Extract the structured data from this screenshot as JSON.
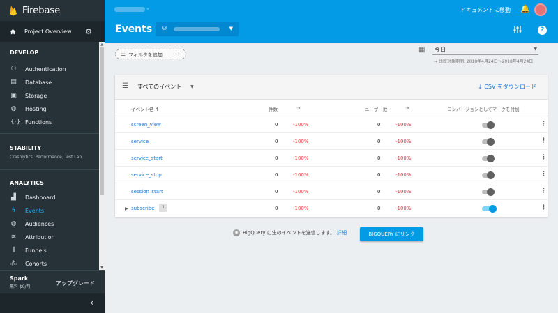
{
  "app": {
    "name": "Firebase"
  },
  "sidebar": {
    "overview_label": "Project Overview",
    "sections": {
      "develop": "DEVELOP",
      "stability": "STABILITY",
      "stability_sub": "Crashlytics, Performance, Test Lab",
      "analytics": "ANALYTICS"
    },
    "develop_items": [
      "Authentication",
      "Database",
      "Storage",
      "Hosting",
      "Functions"
    ],
    "analytics_items": [
      "Dashboard",
      "Events",
      "Audiences",
      "Attribution",
      "Funnels",
      "Cohorts"
    ],
    "active_item": "Events",
    "plan": {
      "name": "Spark",
      "price": "無料 $0/月",
      "upgrade": "アップグレード"
    }
  },
  "header": {
    "docs_link": "ドキュメントに移動",
    "title": "Events"
  },
  "filters": {
    "add_filter": "フィルタを追加",
    "date_range": "今日",
    "compare": "比較対象期間: 2018年4月24日〜2018年4月24日"
  },
  "card": {
    "event_selector": "すべてのイベント",
    "download": "CSV をダウンロード",
    "columns": {
      "name": "イベント名 ↑",
      "count": "件数",
      "users": "ユーザー数",
      "conversion": "コンバージョンとしてマークを付加"
    },
    "rows": [
      {
        "name": "screen_view",
        "count": "0",
        "count_change": "-100%",
        "users": "0",
        "users_change": "-100%",
        "conversion": false
      },
      {
        "name": "service",
        "count": "0",
        "count_change": "-100%",
        "users": "0",
        "users_change": "-100%",
        "conversion": false
      },
      {
        "name": "service_start",
        "count": "0",
        "count_change": "-100%",
        "users": "0",
        "users_change": "-100%",
        "conversion": false
      },
      {
        "name": "service_stop",
        "count": "0",
        "count_change": "-100%",
        "users": "0",
        "users_change": "-100%",
        "conversion": false
      },
      {
        "name": "session_start",
        "count": "0",
        "count_change": "-100%",
        "users": "0",
        "users_change": "-100%",
        "conversion": false
      },
      {
        "name": "subscribe",
        "badge": "1",
        "count": "0",
        "count_change": "-100%",
        "users": "0",
        "users_change": "-100%",
        "conversion": true
      }
    ]
  },
  "bigquery": {
    "text": "BigQuery に生のイベントを送信します。",
    "more": "詳細",
    "button": "BIGQUERY にリンク"
  },
  "colors": {
    "header": "#039be5",
    "sidebar": "#263238",
    "accent": "#29b6f6",
    "negative": "#e53935"
  },
  "icons": [
    "flame-icon",
    "home-icon",
    "gear-icon",
    "people-icon",
    "database-icon",
    "storage-icon",
    "globe-icon",
    "functions-icon",
    "bar-chart-icon",
    "lightning-icon",
    "audience-globe-icon",
    "attribution-icon",
    "funnel-icon",
    "cohort-icon",
    "bell-icon",
    "tune-icon",
    "help-icon",
    "filter-icon",
    "calendar-icon",
    "download-icon",
    "bigquery-icon",
    "chevron-left-icon"
  ]
}
